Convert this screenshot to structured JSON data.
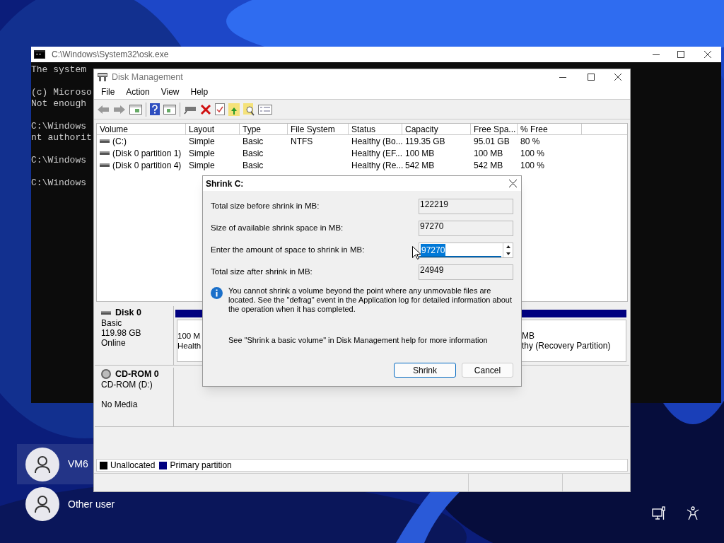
{
  "console": {
    "title": "C:\\Windows\\System32\\osk.exe",
    "groups": [
      [
        "The system"
      ],
      [
        "(c) Microso",
        "Not enough"
      ],
      [
        "C:\\Windows",
        "nt authorit"
      ],
      [
        "C:\\Windows"
      ],
      [
        "C:\\Windows"
      ]
    ]
  },
  "disk_management": {
    "title": "Disk Management",
    "menu": [
      "File",
      "Action",
      "View",
      "Help"
    ],
    "columns": [
      "Volume",
      "Layout",
      "Type",
      "File System",
      "Status",
      "Capacity",
      "Free Spa...",
      "% Free"
    ],
    "rows": [
      {
        "cells": [
          "(C:)",
          "Simple",
          "Basic",
          "NTFS",
          "Healthy (Bo...",
          "119.35 GB",
          "95.01 GB",
          "80 %"
        ]
      },
      {
        "cells": [
          "(Disk 0 partition 1)",
          "Simple",
          "Basic",
          "",
          "Healthy (EF...",
          "100 MB",
          "100 MB",
          "100 %"
        ]
      },
      {
        "cells": [
          "(Disk 0 partition 4)",
          "Simple",
          "Basic",
          "",
          "Healthy (Re...",
          "542 MB",
          "542 MB",
          "100 %"
        ]
      }
    ],
    "disks": [
      {
        "kind": "disk",
        "name": "Disk 0",
        "groups": [
          [
            "Basic",
            "119.98 GB",
            "Online"
          ]
        ],
        "left_partition": [
          "100 M",
          "Health"
        ],
        "right_partition": [
          "MB",
          "thy (Recovery Partition)"
        ]
      },
      {
        "kind": "cdrom",
        "name": "CD-ROM 0",
        "groups": [
          [
            "CD-ROM (D:)"
          ],
          [
            "No Media"
          ]
        ]
      }
    ],
    "legend": [
      {
        "label": "Unallocated",
        "color": "#000000"
      },
      {
        "label": "Primary partition",
        "color": "#000080"
      }
    ]
  },
  "dialog": {
    "title": "Shrink C:",
    "fields": [
      {
        "kind": "readonly",
        "label": "Total size before shrink in MB:",
        "value": "122219"
      },
      {
        "kind": "readonly",
        "label": "Size of available shrink space in MB:",
        "value": "97270"
      },
      {
        "kind": "spin",
        "label": "Enter the amount of space to shrink in MB:",
        "value": "97270",
        "selected": true
      },
      {
        "kind": "readonly",
        "label": "Total size after shrink in MB:",
        "value": "24949"
      }
    ],
    "info": "You cannot shrink a volume beyond the point where any unmovable files are located. See the \"defrag\" event in the Application log for detailed information about the operation when it has completed.",
    "help": "See \"Shrink a basic volume\" in Disk Management help for more information",
    "buttons": [
      {
        "label": "Shrink",
        "default": true
      },
      {
        "label": "Cancel",
        "default": false
      }
    ]
  },
  "users": [
    {
      "name": "VM6",
      "selected": true
    },
    {
      "name": "Other user",
      "selected": false
    }
  ]
}
